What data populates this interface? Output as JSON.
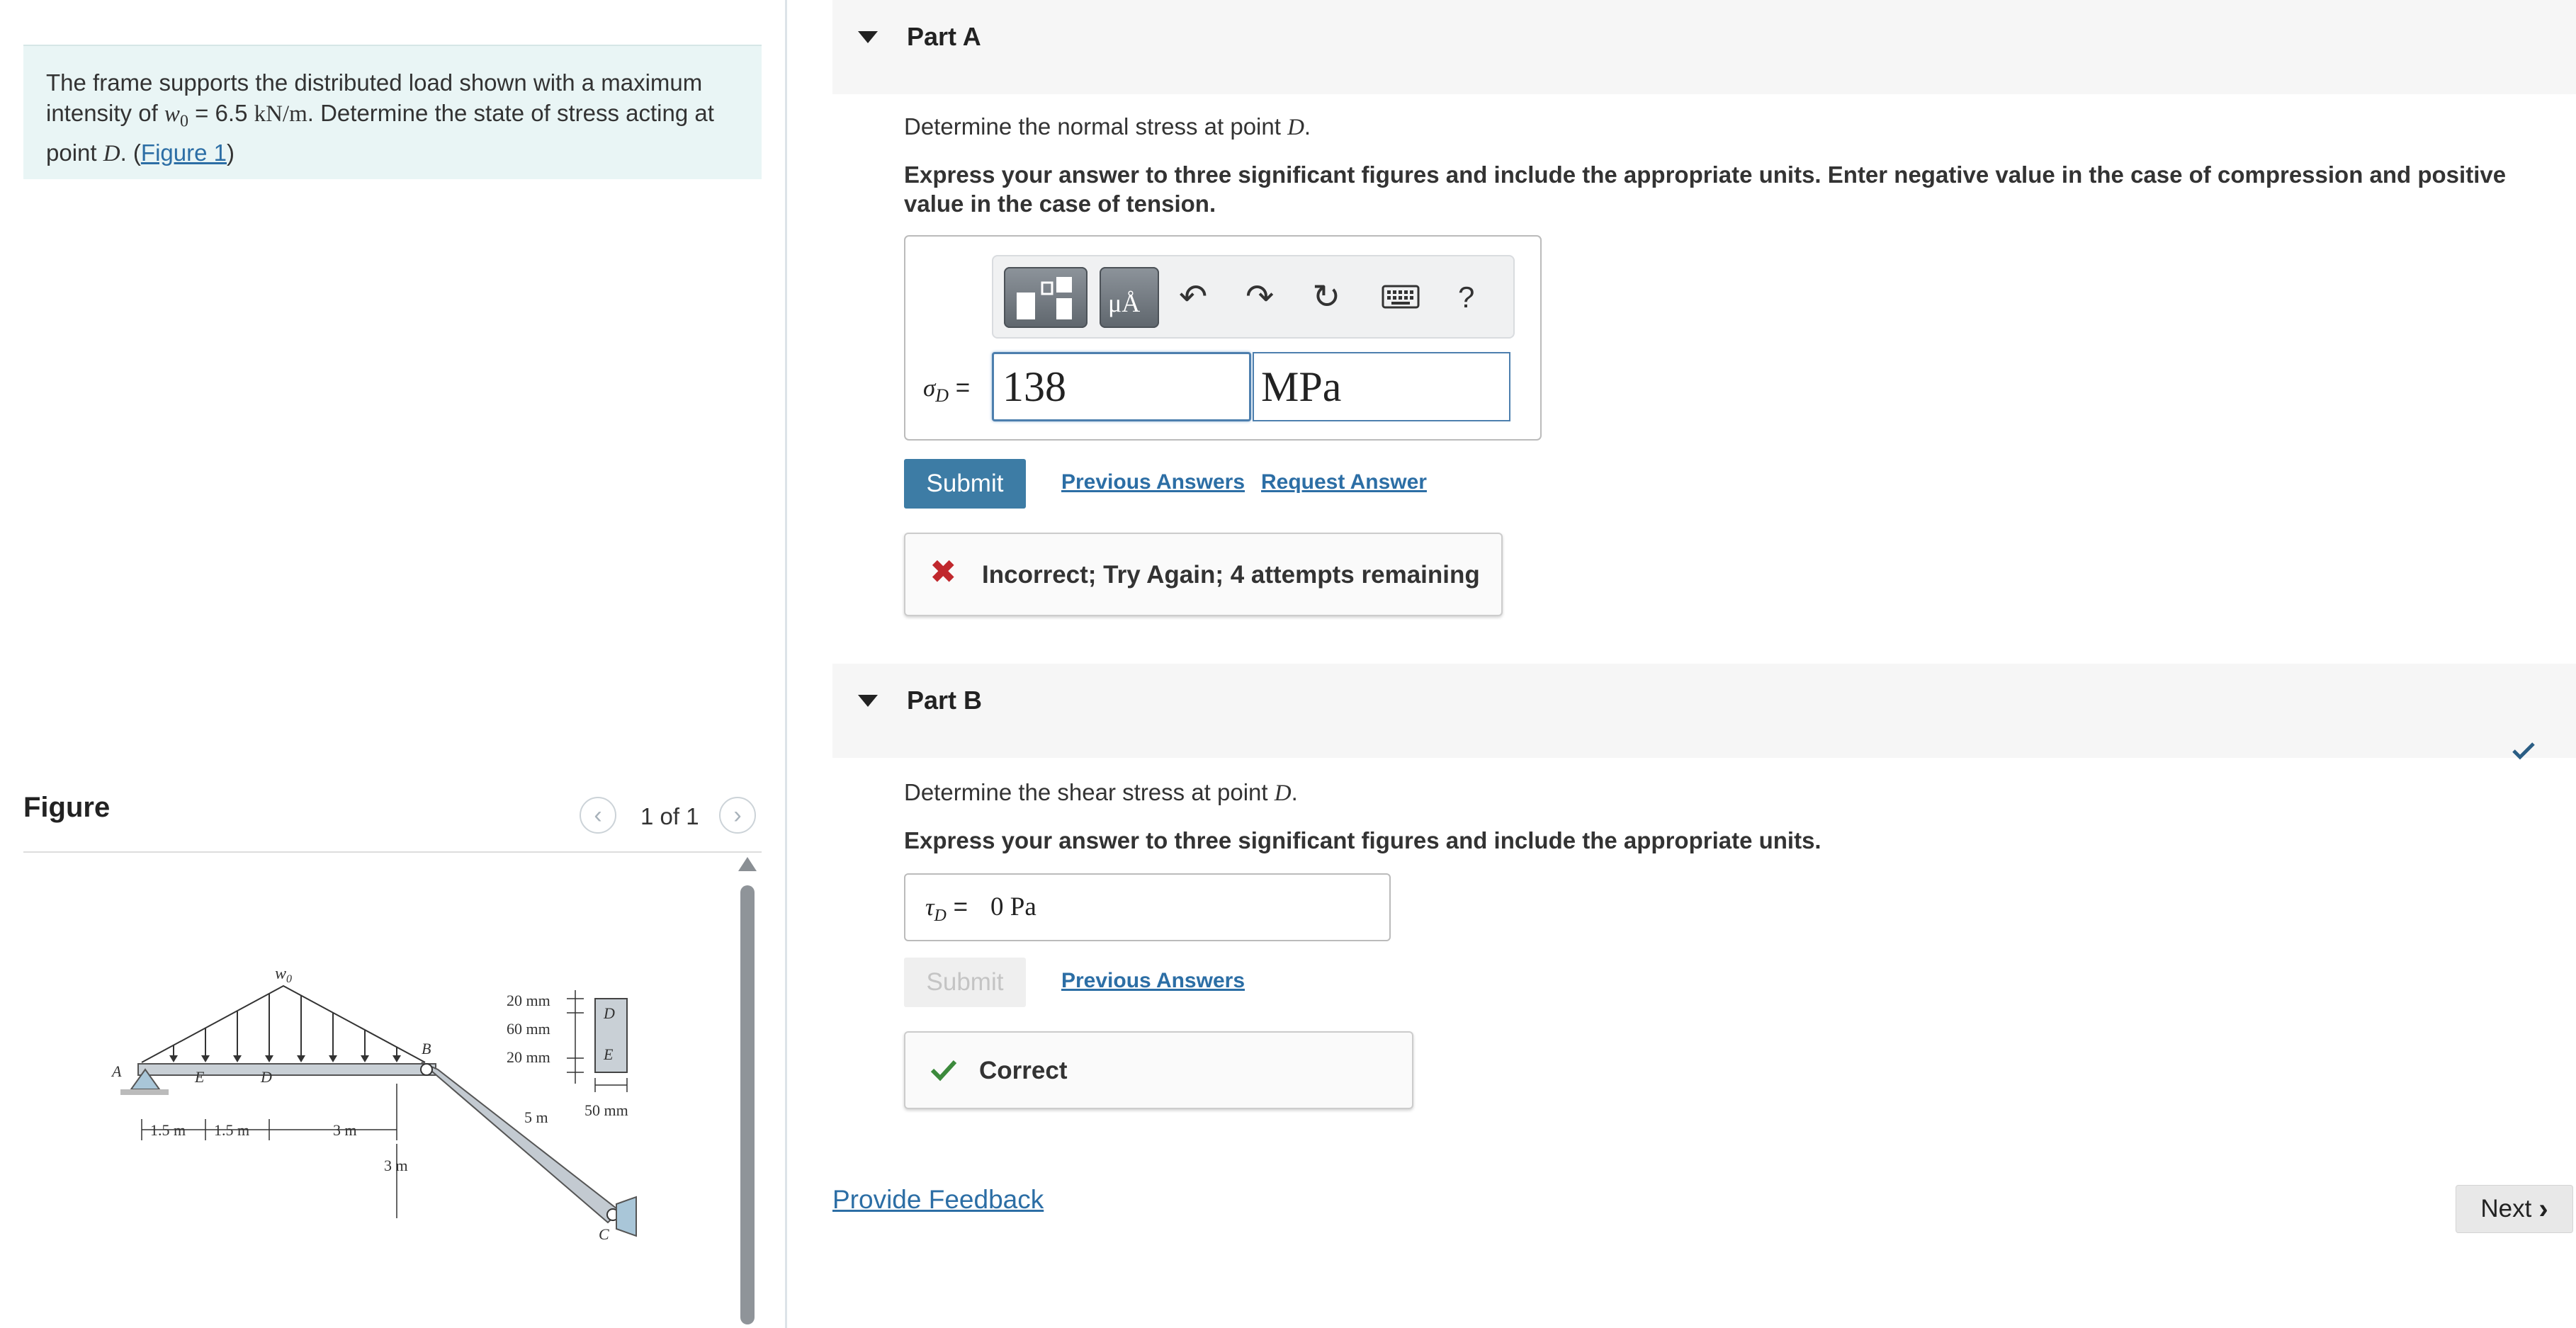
{
  "problem": {
    "text_1": "The frame supports the distributed load shown with a maximum intensity of ",
    "w_symbol": "w",
    "w_subscript": "0",
    "equals_value": " = 6.5 ",
    "unit": "kN/m",
    "text_2": ". Determine the state of stress acting at point ",
    "point": "D",
    "text_3": ". (",
    "figure_link": "Figure 1",
    "text_4": ")"
  },
  "figure": {
    "heading": "Figure",
    "counter": "1 of 1",
    "prev_icon": "chevron-left-icon",
    "next_icon": "chevron-right-icon",
    "labels": {
      "w0": "w",
      "w0_sub": "0",
      "A": "A",
      "E_beam": "E",
      "D_beam": "D",
      "B": "B",
      "C": "C",
      "D_section": "D",
      "E_section": "E",
      "dim_20a": "20 mm",
      "dim_60": "60 mm",
      "dim_20b": "20 mm",
      "dim_50": "50 mm",
      "dim_15a": "1.5 m",
      "dim_15b": "1.5 m",
      "dim_3h": "3 m",
      "dim_3v": "3 m",
      "dim_5": "5 m"
    }
  },
  "partA": {
    "title": "Part A",
    "question_text": "Determine the normal stress at point ",
    "question_point": "D",
    "question_end": ".",
    "instruction": "Express your answer to three significant figures and include the appropriate units. Enter negative value in the case of compression and positive value in the case of tension.",
    "toolbar": {
      "units_glyph": "μÅ",
      "help": "?",
      "icons": [
        "templates-icon",
        "units-icon",
        "undo-icon",
        "redo-icon",
        "reset-icon",
        "keyboard-icon",
        "help-icon"
      ]
    },
    "variable": "σ",
    "variable_sub": "D",
    "equals": " =",
    "value": "138",
    "units": "MPa",
    "submit_label": "Submit",
    "previous_answers": "Previous Answers",
    "request_answer": "Request Answer",
    "feedback": "Incorrect; Try Again; 4 attempts remaining",
    "feedback_color": "#c0282d"
  },
  "partB": {
    "title": "Part B",
    "question_text": "Determine the shear stress at point ",
    "question_point": "D",
    "question_end": ".",
    "instruction": "Express your answer to three significant figures and include the appropriate units.",
    "variable": "τ",
    "variable_sub": "D",
    "equals": " =",
    "value": "0 Pa",
    "submit_label": "Submit",
    "previous_answers": "Previous Answers",
    "feedback": "Correct",
    "feedback_color": "#3c8a3c"
  },
  "footer": {
    "provide_feedback": "Provide Feedback",
    "next_label": "Next"
  }
}
